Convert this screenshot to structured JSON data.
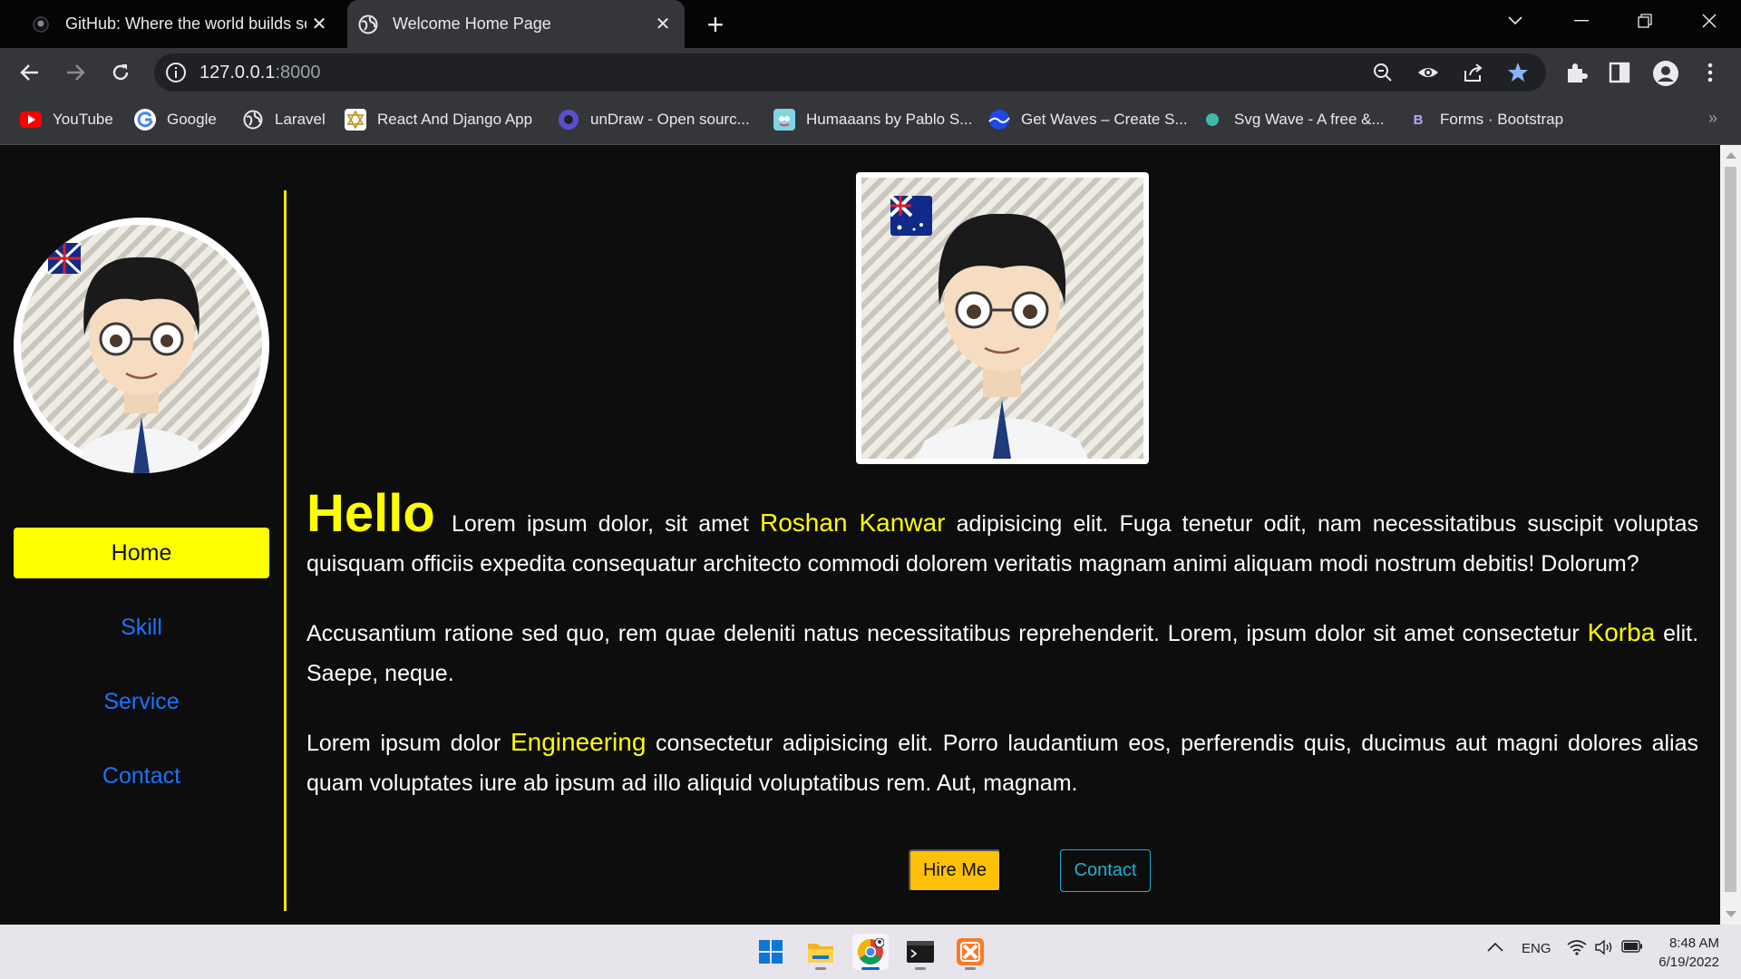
{
  "browser": {
    "tabs": [
      {
        "title": "GitHub: Where the world builds software",
        "active": false,
        "favicon": "github-icon"
      },
      {
        "title": "Welcome Home Page",
        "active": true,
        "favicon": "globe-icon"
      }
    ],
    "new_tab": "+",
    "url_host": "127.0.0.1",
    "url_port": ":8000",
    "bookmarks": [
      {
        "label": "YouTube",
        "icon": "youtube-icon"
      },
      {
        "label": "Google",
        "icon": "google-icon"
      },
      {
        "label": "Laravel",
        "icon": "globe-icon"
      },
      {
        "label": "React And Django App",
        "icon": "star-of-david-icon"
      },
      {
        "label": "unDraw - Open sourc...",
        "icon": "undraw-icon"
      },
      {
        "label": "Humaaans by Pablo S...",
        "icon": "humaaans-icon"
      },
      {
        "label": "Get Waves – Create S...",
        "icon": "waves-icon"
      },
      {
        "label": "Svg Wave - A free &...",
        "icon": "dot-icon"
      },
      {
        "label": "Forms · Bootstrap",
        "icon": "bootstrap-icon",
        "glyph": "B"
      }
    ],
    "bookmarks_more": "»"
  },
  "sidebar": {
    "nav": [
      {
        "label": "Home",
        "active": true
      },
      {
        "label": "Skill",
        "active": false
      },
      {
        "label": "Service",
        "active": false
      },
      {
        "label": "Contact",
        "active": false
      }
    ]
  },
  "main": {
    "hello": "Hello",
    "p1_a": "Lorem ipsum dolor, sit amet",
    "p1_name": "Roshan Kanwar",
    "p1_b": "adipisicing elit. Fuga tenetur odit, nam necessitatibus suscipit voluptas quisquam officiis expedita consequatur architecto commodi dolorem veritatis magnam animi aliquam modi nostrum debitis! Dolorum?",
    "p2_a": "Accusantium ratione sed quo, rem quae deleniti natus necessitatibus reprehenderit. Lorem, ipsum dolor sit amet consectetur",
    "p2_hl": "Korba",
    "p2_b": "elit. Saepe, neque.",
    "p3_a": "Lorem ipsum dolor",
    "p3_hl": "Engineering",
    "p3_b": "consectetur adipisicing elit. Porro laudantium eos, perferendis quis, ducimus aut magni dolores alias quam voluptates iure ab ipsum ad illo aliquid voluptatibus rem. Aut, magnam.",
    "btn_hire": "Hire Me",
    "btn_contact": "Contact"
  },
  "taskbar": {
    "apps": [
      "windows-start-icon",
      "file-explorer-icon",
      "chrome-icon",
      "terminal-icon",
      "xampp-icon"
    ],
    "lang": "ENG",
    "time": "8:48 AM",
    "date": "6/19/2022"
  },
  "colors": {
    "accent_yellow": "#ffff00",
    "link_blue": "#1a73ff",
    "hire_button": "#ffc107",
    "contact_outline": "#17b3d6",
    "page_bg": "#0d0d0d"
  }
}
